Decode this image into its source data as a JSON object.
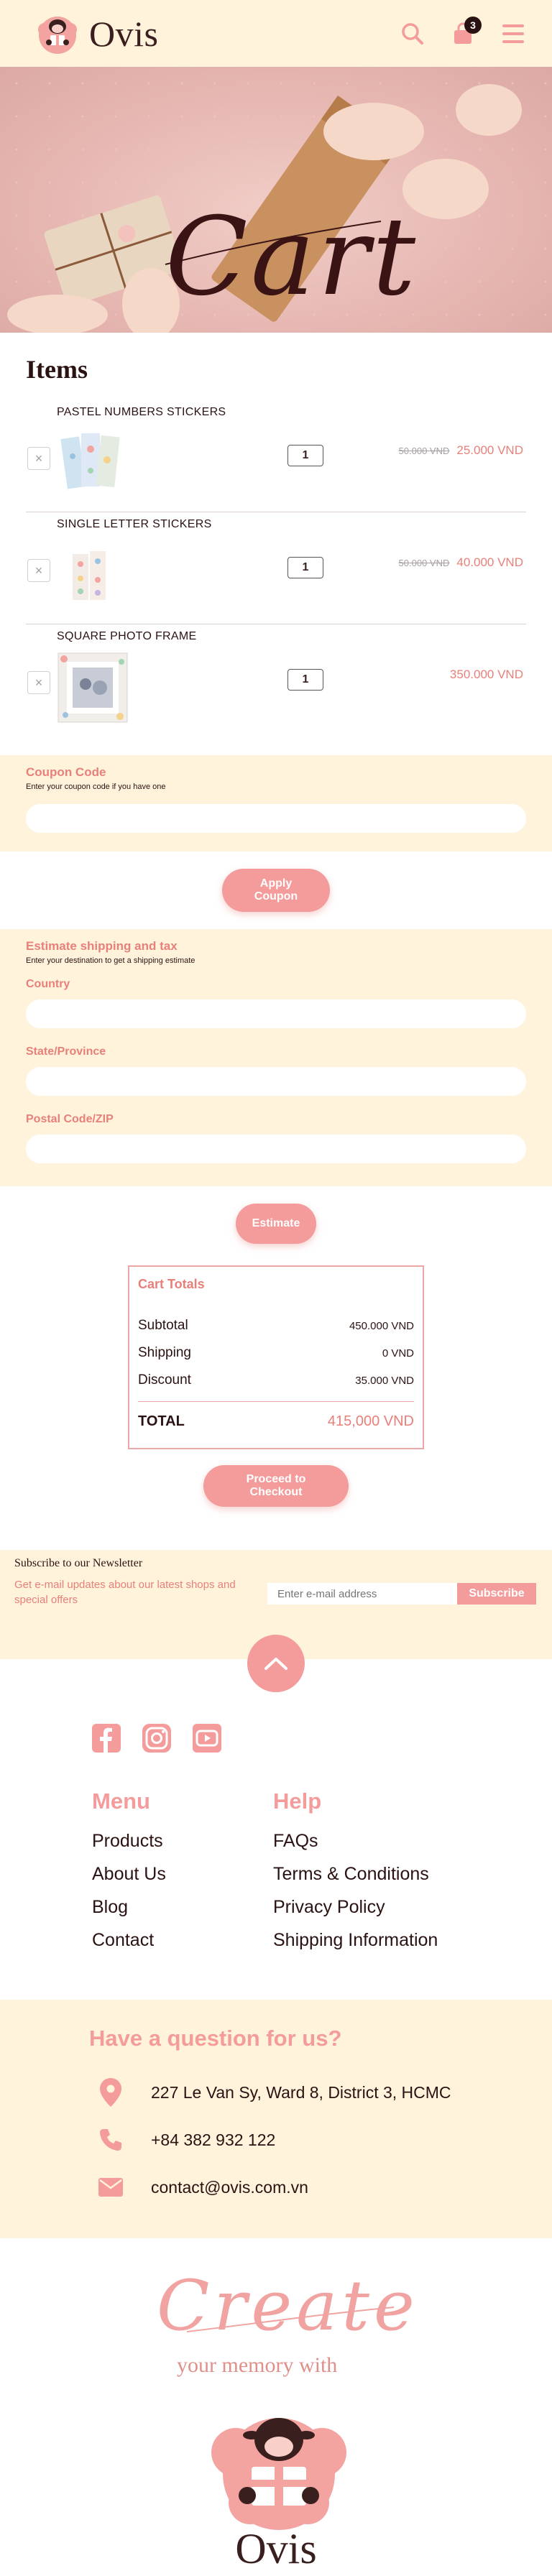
{
  "header": {
    "brand": "Ovis",
    "cart_count": "3",
    "icons": [
      "search-icon",
      "cart-icon",
      "menu-icon"
    ]
  },
  "hero": {
    "title": "Cart"
  },
  "items_section": {
    "title": "Items",
    "items": [
      {
        "name": "PASTEL NUMBERS STICKERS",
        "qty": "1",
        "old_price": "50.000 VND",
        "price": "25.000 VND"
      },
      {
        "name": "SINGLE LETTER STICKERS",
        "qty": "1",
        "old_price": "50.000 VND",
        "price": "40.000 VND"
      },
      {
        "name": "SQUARE PHOTO FRAME",
        "qty": "1",
        "old_price": "",
        "price": "350.000 VND"
      }
    ],
    "remove_symbol": "×"
  },
  "coupon": {
    "label": "Coupon Code",
    "hint": "Enter your coupon code if you have one",
    "placeholder": "",
    "button": "Apply Coupon"
  },
  "shipping": {
    "label": "Estimate shipping and tax",
    "hint": "Enter your destination to get a shipping estimate",
    "country_label": "Country",
    "state_label": "State/Province",
    "postal_label": "Postal Code/ZIP",
    "button": "Estimate"
  },
  "totals": {
    "title": "Cart Totals",
    "subtotal_label": "Subtotal",
    "subtotal": "450.000 VND",
    "shipping_label": "Shipping",
    "shipping": "0 VND",
    "discount_label": "Discount",
    "discount": "35.000 VND",
    "total_label": "TOTAL",
    "total": "415,000 VND",
    "checkout_button": "Proceed to Checkout"
  },
  "newsletter": {
    "title": "Subscribe to our Newsletter",
    "desc": "Get e-mail updates about our latest shops and special offers",
    "placeholder": "Enter e-mail address",
    "button": "Subscribe"
  },
  "footer": {
    "social": [
      "facebook-icon",
      "instagram-icon",
      "youtube-icon"
    ],
    "menu_title": "Menu",
    "menu": [
      "Products",
      "About Us",
      "Blog",
      "Contact"
    ],
    "help_title": "Help",
    "help": [
      "FAQs",
      "Terms & Conditions",
      "Privacy Policy",
      "Shipping Information"
    ]
  },
  "contact": {
    "title": "Have a question for us?",
    "address": "227 Le Van Sy, Ward 8,  District 3, HCMC",
    "phone": "+84 382 932 122",
    "email": "contact@ovis.com.vn"
  },
  "promo": {
    "create": "Create",
    "subtitle": "your memory with",
    "brand": "Ovis"
  },
  "colors": {
    "accent": "#f49b9b",
    "accent_text": "#e8807a",
    "cream": "#fff3dc",
    "dark": "#2b1212"
  }
}
